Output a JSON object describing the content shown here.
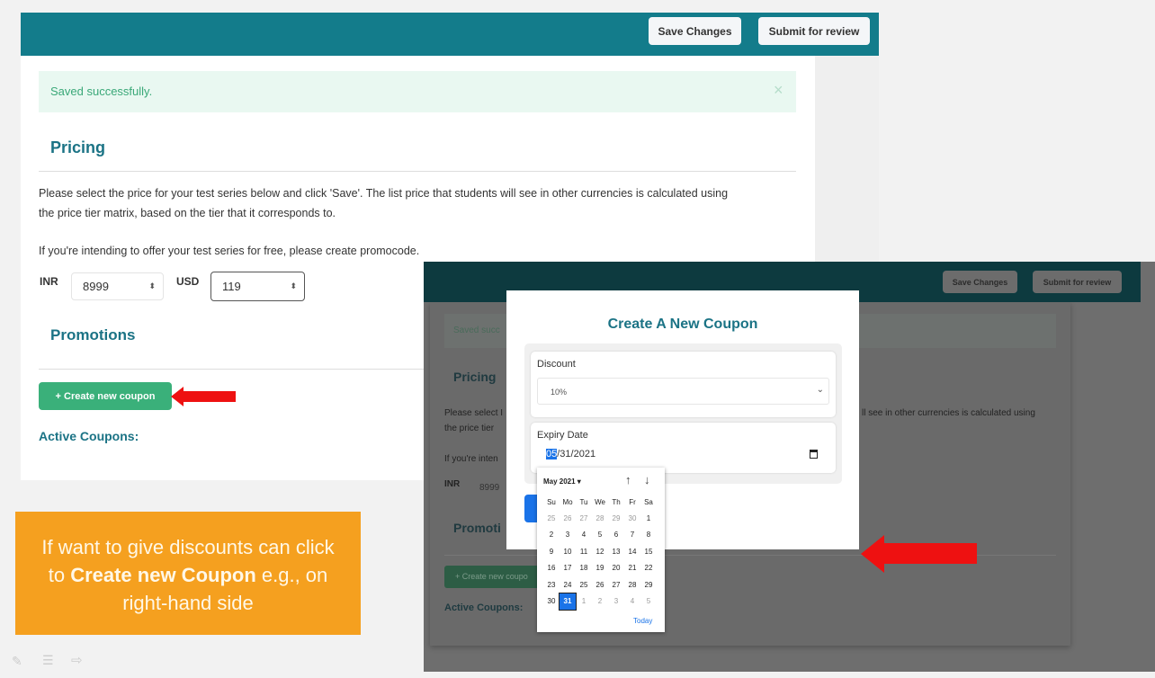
{
  "left": {
    "header": {
      "save_label": "Save Changes",
      "submit_label": "Submit for review"
    },
    "alert": {
      "text": "Saved successfully.",
      "close": "×"
    },
    "pricing": {
      "title": "Pricing",
      "desc1": "Please select the price for your test series below and click 'Save'. The list price that students will see in other currencies is calculated using",
      "desc2": "the price tier matrix, based on the tier that it corresponds to.",
      "free_note": "If you're intending to offer your test series for free, please create promocode.",
      "inr_label": "INR",
      "inr_value": "8999",
      "usd_label": "USD",
      "usd_value": "119"
    },
    "promotions": {
      "title": "Promotions",
      "create_label": "+ Create new coupon",
      "active_label": "Active Coupons:"
    }
  },
  "callout": {
    "line1": "If want to give discounts can click",
    "line2_pre": "to ",
    "line2_bold": "Create new Coupon",
    "line2_post": " e.g., on",
    "line3": "right-hand side"
  },
  "right": {
    "header": {
      "save_label": "Save Changes",
      "submit_label": "Submit for review"
    },
    "bg": {
      "alert": "Saved succ",
      "pricing": "Pricing",
      "desc1a": "Please select I",
      "desc1b": "ll see in other currencies is calculated using",
      "desc2": "the price tier",
      "free": "If you're inten",
      "inr": "INR",
      "inr_value": "8999",
      "promo": "Promoti",
      "create": "+ Create new coupo",
      "active": "Active Coupons:"
    },
    "modal": {
      "title": "Create A New Coupon",
      "discount_label": "Discount",
      "discount_value": "10%",
      "expiry_label": "Expiry Date",
      "expiry_month": "05",
      "expiry_rest": "/31/2021"
    },
    "calendar": {
      "month": "May 2021 ▾",
      "today": "Today",
      "weekdays": [
        "Su",
        "Mo",
        "Tu",
        "We",
        "Th",
        "Fr",
        "Sa"
      ],
      "weeks": [
        [
          "25",
          "26",
          "27",
          "28",
          "29",
          "30",
          "1"
        ],
        [
          "2",
          "3",
          "4",
          "5",
          "6",
          "7",
          "8"
        ],
        [
          "9",
          "10",
          "11",
          "12",
          "13",
          "14",
          "15"
        ],
        [
          "16",
          "17",
          "18",
          "19",
          "20",
          "21",
          "22"
        ],
        [
          "23",
          "24",
          "25",
          "26",
          "27",
          "28",
          "29"
        ],
        [
          "30",
          "31",
          "1",
          "2",
          "3",
          "4",
          "5"
        ]
      ],
      "selected": "31"
    }
  },
  "colors": {
    "teal_header": "#137c8b",
    "green_button": "#3ab07a",
    "orange": "#f5a01f",
    "arrow": "#ee1111"
  }
}
